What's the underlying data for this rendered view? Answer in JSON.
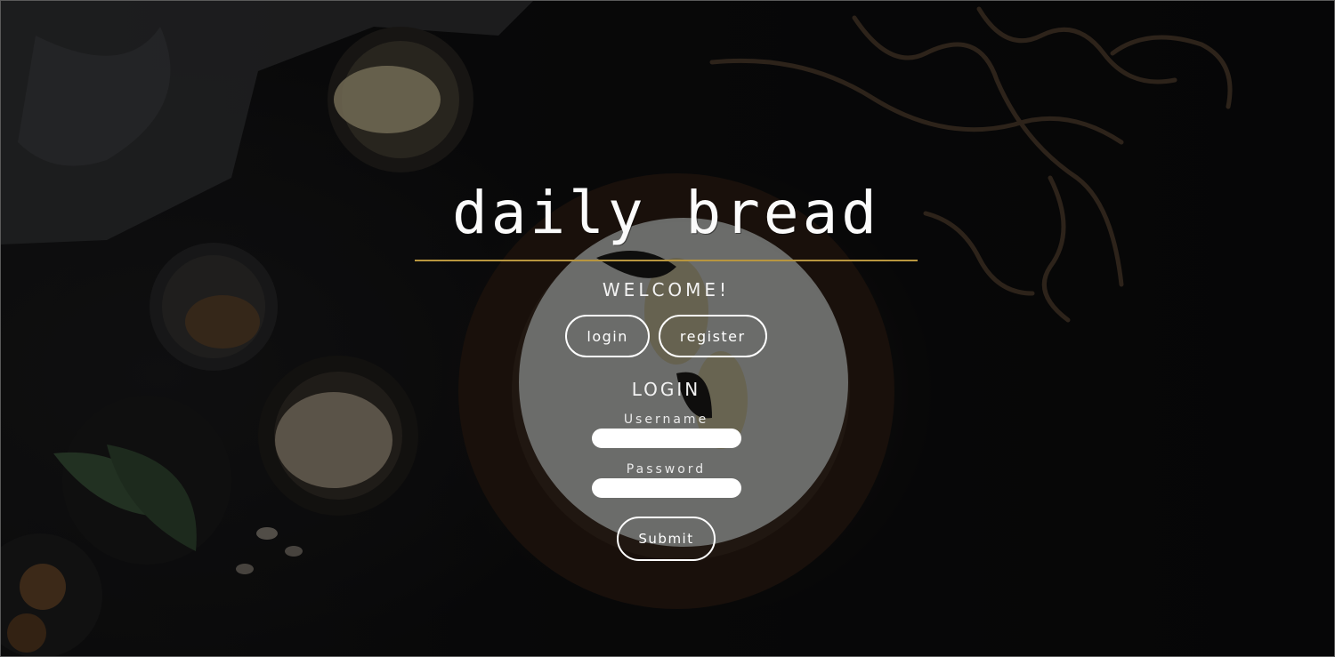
{
  "brand": {
    "title": "daily bread"
  },
  "welcome": {
    "text": "WELCOME!"
  },
  "tabs": {
    "login_label": "login",
    "register_label": "register"
  },
  "login_form": {
    "heading": "LOGIN",
    "username_label": "Username",
    "password_label": "Password",
    "username_value": "",
    "password_value": "",
    "submit_label": "Submit"
  },
  "colors": {
    "accent_rule": "#b8963f",
    "text": "#ffffff",
    "background": "#0c0c0d"
  }
}
